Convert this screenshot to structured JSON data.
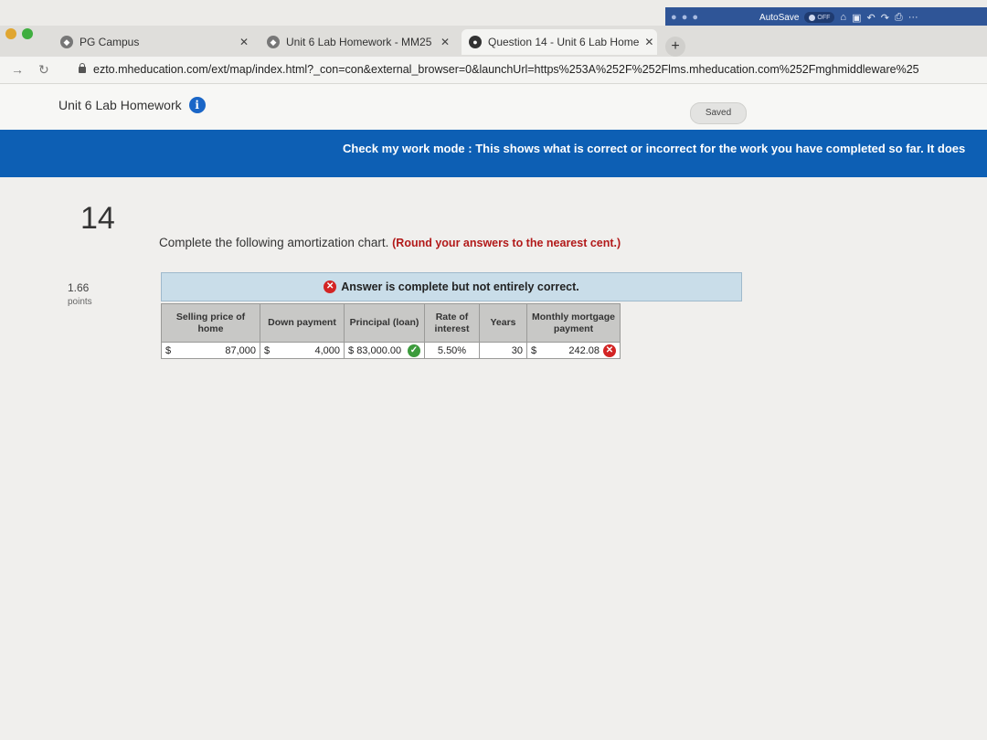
{
  "office": {
    "autosave_label": "AutoSave",
    "autosave_state": "OFF"
  },
  "browser": {
    "tabs": [
      {
        "label": "PG Campus"
      },
      {
        "label": "Unit 6 Lab Homework - MM25"
      },
      {
        "label": "Question 14 - Unit 6 Lab Home"
      }
    ],
    "new_tab_symbol": "+",
    "url": "ezto.mheducation.com/ext/map/index.html?_con=con&external_browser=0&launchUrl=https%253A%252F%252Flms.mheducation.com%252Fmghmiddleware%25"
  },
  "app": {
    "title": "Unit 6 Lab Homework",
    "saved_label": "Saved",
    "banner": "Check my work mode : This shows what is correct or incorrect for the work you have completed so far. It does"
  },
  "question": {
    "number": "14",
    "points": "1.66",
    "points_label": "points",
    "prompt": "Complete the following amortization chart.",
    "round_note": "(Round your answers to the nearest cent.)",
    "status": "Answer is complete but not entirely correct."
  },
  "table": {
    "headers": {
      "selling_price": "Selling price of home",
      "down_payment": "Down payment",
      "principal": "Principal (loan)",
      "rate": "Rate of interest",
      "years": "Years",
      "monthly": "Monthly mortgage payment"
    },
    "row": {
      "currency": "$",
      "selling_price": "87,000",
      "down_payment": "4,000",
      "principal": "83,000.00",
      "rate": "5.50%",
      "years": "30",
      "monthly": "242.08"
    }
  },
  "colors": {
    "banner": "#0d5fb4",
    "correct": "#3c9b3c",
    "incorrect": "#d32424"
  }
}
